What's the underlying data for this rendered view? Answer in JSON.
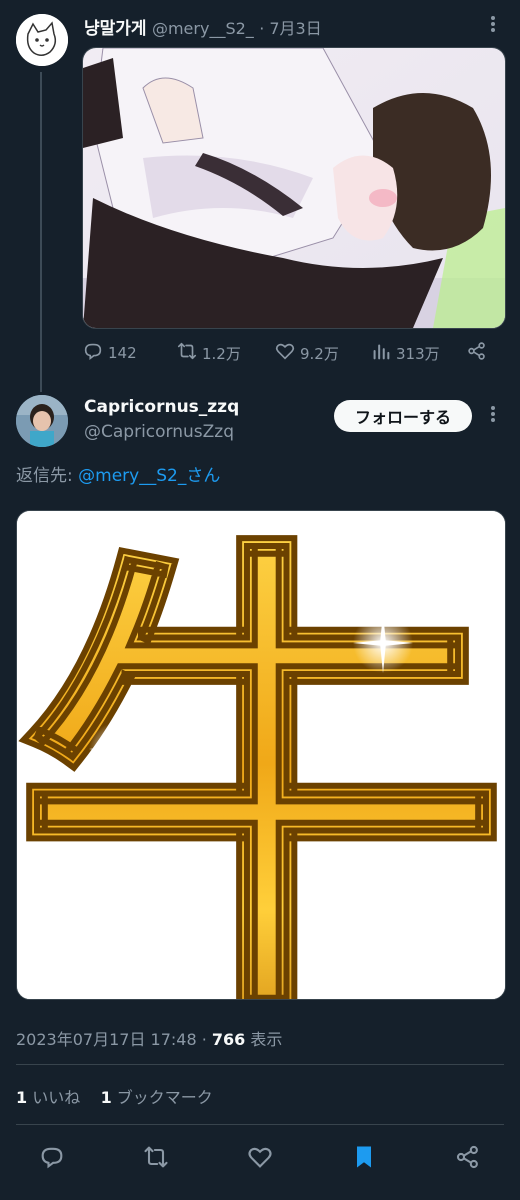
{
  "parent_tweet": {
    "display_name": "냥말가게",
    "handle": "@mery__S2_",
    "date": "· 7月3日",
    "actions": {
      "replies": "142",
      "retweets": "1.2万",
      "likes": "9.2万",
      "views": "313万"
    }
  },
  "reply_tweet": {
    "display_name": "Capricornus_zzq",
    "handle": "@CapricornusZzq",
    "follow_label": "フォローする",
    "reply_prefix": "返信先: ",
    "reply_target": "@mery__S2_さん",
    "image_glyph": "牛",
    "timestamp": "2023年07月17日 17:48 · ",
    "views_count": "766",
    "views_label": " 表示",
    "likes_count": "1",
    "likes_label": " いいね",
    "bookmarks_count": "1",
    "bookmarks_label": " ブックマーク"
  },
  "icons": {
    "reply": "reply-icon",
    "retweet": "retweet-icon",
    "like": "heart-icon",
    "views": "views-icon",
    "share": "share-icon",
    "bookmark": "bookmark-icon",
    "more": "more-icon"
  },
  "colors": {
    "background": "#15202b",
    "text": "#f7f9f9",
    "muted": "#8b98a5",
    "link": "#1d9bf0",
    "bookmark_active": "#1d9bf0",
    "gold": "#f3b61a"
  }
}
